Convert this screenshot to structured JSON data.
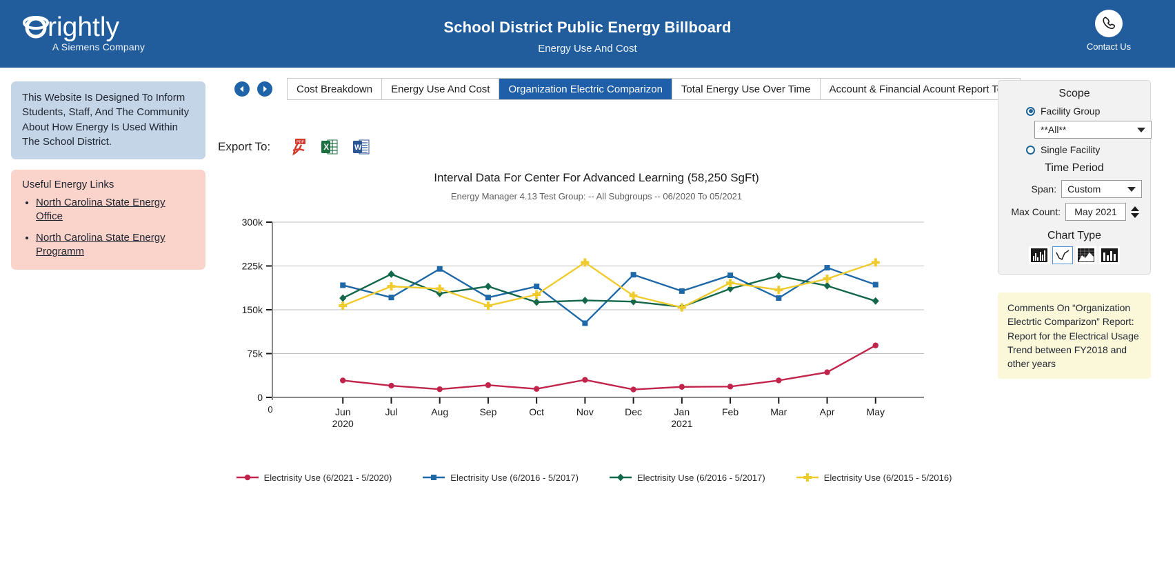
{
  "header": {
    "logo_text": "rightly",
    "logo_tagline": "A Siemens Company",
    "title": "School District Public Energy Billboard",
    "subtitle": "Energy Use And Cost",
    "contact_label": "Contact Us",
    "contact_icon": "phone-icon",
    "bg_color": "#215d9c"
  },
  "sidebar": {
    "info_text": "This Website Is Designed To Inform Students, Staff, And The Community About How Energy Is Used Within The School District.",
    "links_title": "Useful Energy Links",
    "links": [
      {
        "label": "North Carolina State Energy Office"
      },
      {
        "label": "North Carolina State Energy Programm"
      }
    ],
    "info_bg": "#c3d5e6",
    "links_bg": "#fad4ca"
  },
  "nav": {
    "back_icon": "arrow-left-circle-icon",
    "forward_icon": "arrow-right-circle-icon"
  },
  "tabs": [
    {
      "label": "Cost Breakdown",
      "active": false
    },
    {
      "label": "Energy Use And Cost",
      "active": false
    },
    {
      "label": "Organization Electric Comparizon",
      "active": true
    },
    {
      "label": "Total Energy Use Over Time",
      "active": false
    },
    {
      "label": "Account & Financial Acount Report Test",
      "active": false
    }
  ],
  "export": {
    "label": "Export To:",
    "items": [
      {
        "name": "pdf-export-icon",
        "type": "PDF",
        "color": "#d33a2c"
      },
      {
        "name": "excel-export-icon",
        "type": "XLS",
        "color": "#1d6f42"
      },
      {
        "name": "word-export-icon",
        "type": "DOC",
        "color": "#2b5797"
      }
    ]
  },
  "chart_data": {
    "type": "line",
    "title": "Interval Data For Center For Advanced Learning  (58,250 SgFt)",
    "subtitle": "Energy Manager 4.13 Test  Group: -- All Subgroups -- 06/2020 To 05/2021",
    "xlabel": "",
    "ylabel": "",
    "ylim": [
      0,
      300000
    ],
    "yticks": [
      0,
      75000,
      150000,
      225000,
      300000
    ],
    "ytick_labels": [
      "0",
      "75k",
      "150k",
      "225k",
      "300k"
    ],
    "grid": true,
    "legend_position": "bottom",
    "origin_label": "0",
    "categories": [
      "Jun",
      "Jul",
      "Aug",
      "Sep",
      "Oct",
      "Nov",
      "Dec",
      "Jan",
      "Feb",
      "Mar",
      "Apr",
      "May"
    ],
    "category_years": [
      "2020",
      "",
      "",
      "",
      "",
      "",
      "",
      "2021",
      "",
      "",
      "",
      ""
    ],
    "series": [
      {
        "name": "Electrisity Use (6/2021 - 5/2020)",
        "color": "#c2254c",
        "marker": "circle",
        "values": [
          29000,
          20000,
          14000,
          21000,
          14500,
          30000,
          13500,
          18000,
          18500,
          29000,
          43000,
          89000
        ]
      },
      {
        "name": "Electrisity Use (6/2016 - 5/2017)",
        "color": "#1f68a8",
        "marker": "square",
        "values": [
          192000,
          171000,
          220000,
          171000,
          190000,
          127000,
          210000,
          182000,
          209000,
          170000,
          222000,
          193000
        ]
      },
      {
        "name": "Electrisity Use (6/2016 - 5/2017)",
        "color": "#13674a",
        "marker": "diamond",
        "values": [
          170000,
          211000,
          178000,
          190000,
          163000,
          166000,
          164000,
          155000,
          186000,
          208000,
          191000,
          165000
        ]
      },
      {
        "name": "Electrisity Use (6/2015 - 5/2016)",
        "color": "#efcb2e",
        "marker": "cross",
        "values": [
          157000,
          190000,
          186000,
          157000,
          176000,
          231000,
          174000,
          154000,
          196000,
          184000,
          203000,
          231000
        ]
      }
    ]
  },
  "scope": {
    "heading": "Scope",
    "facility_group_label": "Facility Group",
    "facility_group_selected": true,
    "facility_group_value": "**All**",
    "single_facility_label": "Single Facility",
    "single_facility_selected": false,
    "time_period_heading": "Time Period",
    "span_label": "Span:",
    "span_value": "Custom",
    "max_count_label": "Max Count:",
    "max_count_value": "May 2021",
    "chart_type_heading": "Chart Type",
    "chart_types": [
      {
        "name": "bar-chart-icon",
        "selected": false
      },
      {
        "name": "line-chart-icon",
        "selected": true
      },
      {
        "name": "area-chart-icon",
        "selected": false
      },
      {
        "name": "column-chart-icon",
        "selected": false
      }
    ]
  },
  "comments": {
    "text": "Comments On “Organization Electrtic Comparizon” Report: Report for the Electrical Usage Trend between FY2018 and other years",
    "bg_color": "#fbf8da"
  }
}
